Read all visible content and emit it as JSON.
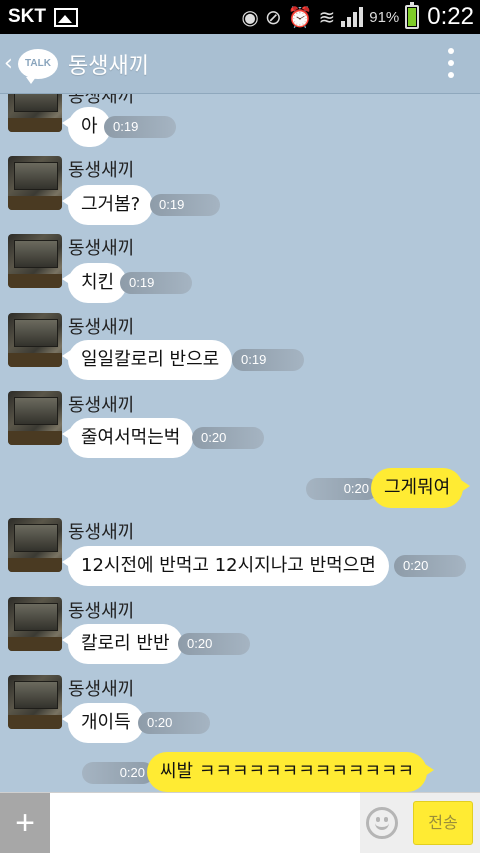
{
  "status_bar": {
    "carrier": "SKT",
    "battery_percent": "91%",
    "battery_level": 0.91,
    "time": "0:22",
    "icons": [
      "image-icon",
      "eye-icon",
      "mute-icon",
      "alarm-icon",
      "wifi-icon",
      "signal-icon",
      "battery-icon"
    ]
  },
  "header": {
    "talk_badge": "TALK",
    "title": "동생새끼"
  },
  "messages": [
    {
      "sender": "동생새끼",
      "text": "아",
      "time": "0:19"
    },
    {
      "sender": "동생새끼",
      "text": "그거봄?",
      "time": "0:19"
    },
    {
      "sender": "동생새끼",
      "text": "치킨",
      "time": "0:19"
    },
    {
      "sender": "동생새끼",
      "text": "일일칼로리 반으로",
      "time": "0:19"
    },
    {
      "sender": "동생새끼",
      "text": "줄여서먹는벅",
      "time": "0:20"
    },
    {
      "sender": "",
      "text": "그게뭐여",
      "time": "0:20"
    },
    {
      "sender": "동생새끼",
      "text": "12시전에 반먹고 12시지나고 반먹으면",
      "time": "0:20"
    },
    {
      "sender": "동생새끼",
      "text": "칼로리 반반",
      "time": "0:20"
    },
    {
      "sender": "동생새끼",
      "text": "개이득",
      "time": "0:20"
    },
    {
      "sender": "",
      "text": "씨발 ㅋㅋㅋㅋㅋㅋㅋㅋㅋㅋㅋㅋㅋ",
      "time": "0:20"
    }
  ],
  "input_bar": {
    "send_label": "전송",
    "message_value": ""
  },
  "colors": {
    "chat_background": "#b2c7d9",
    "incoming_bubble": "#ffffff",
    "outgoing_bubble": "#ffeb33"
  }
}
